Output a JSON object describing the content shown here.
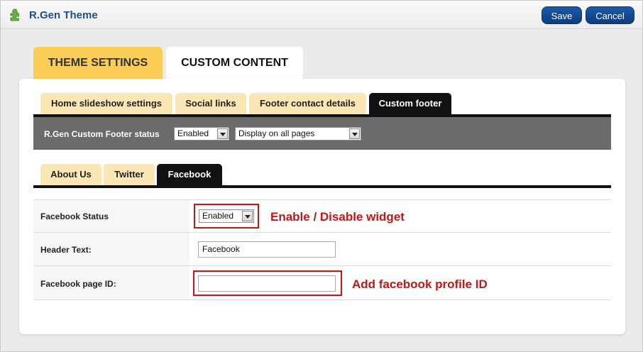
{
  "app": {
    "title": "R.Gen Theme",
    "icon": "puzzle-icon"
  },
  "toolbar": {
    "save_label": "Save",
    "cancel_label": "Cancel"
  },
  "main_tabs": [
    {
      "label": "THEME SETTINGS",
      "active": false
    },
    {
      "label": "CUSTOM CONTENT",
      "active": true
    }
  ],
  "sub_tabs": [
    {
      "label": "Home slideshow settings",
      "active": false
    },
    {
      "label": "Social links",
      "active": false
    },
    {
      "label": "Footer contact details",
      "active": false
    },
    {
      "label": "Custom footer",
      "active": true
    }
  ],
  "footer_status": {
    "label": "R.Gen Custom Footer status",
    "status_value": "Enabled",
    "display_value": "Display on all pages"
  },
  "widget_tabs": [
    {
      "label": "About Us",
      "active": false
    },
    {
      "label": "Twitter",
      "active": false
    },
    {
      "label": "Facebook",
      "active": true
    }
  ],
  "facebook_form": {
    "status_label": "Facebook Status",
    "status_value": "Enabled",
    "status_note": "Enable / Disable widget",
    "header_label": "Header Text:",
    "header_value": "Facebook",
    "page_id_label": "Facebook page ID:",
    "page_id_value": "",
    "page_id_note": "Add facebook profile ID"
  },
  "colors": {
    "accent_blue": "#0c3c80",
    "tab_yellow": "#fbcd55",
    "note_red": "#c81414"
  }
}
